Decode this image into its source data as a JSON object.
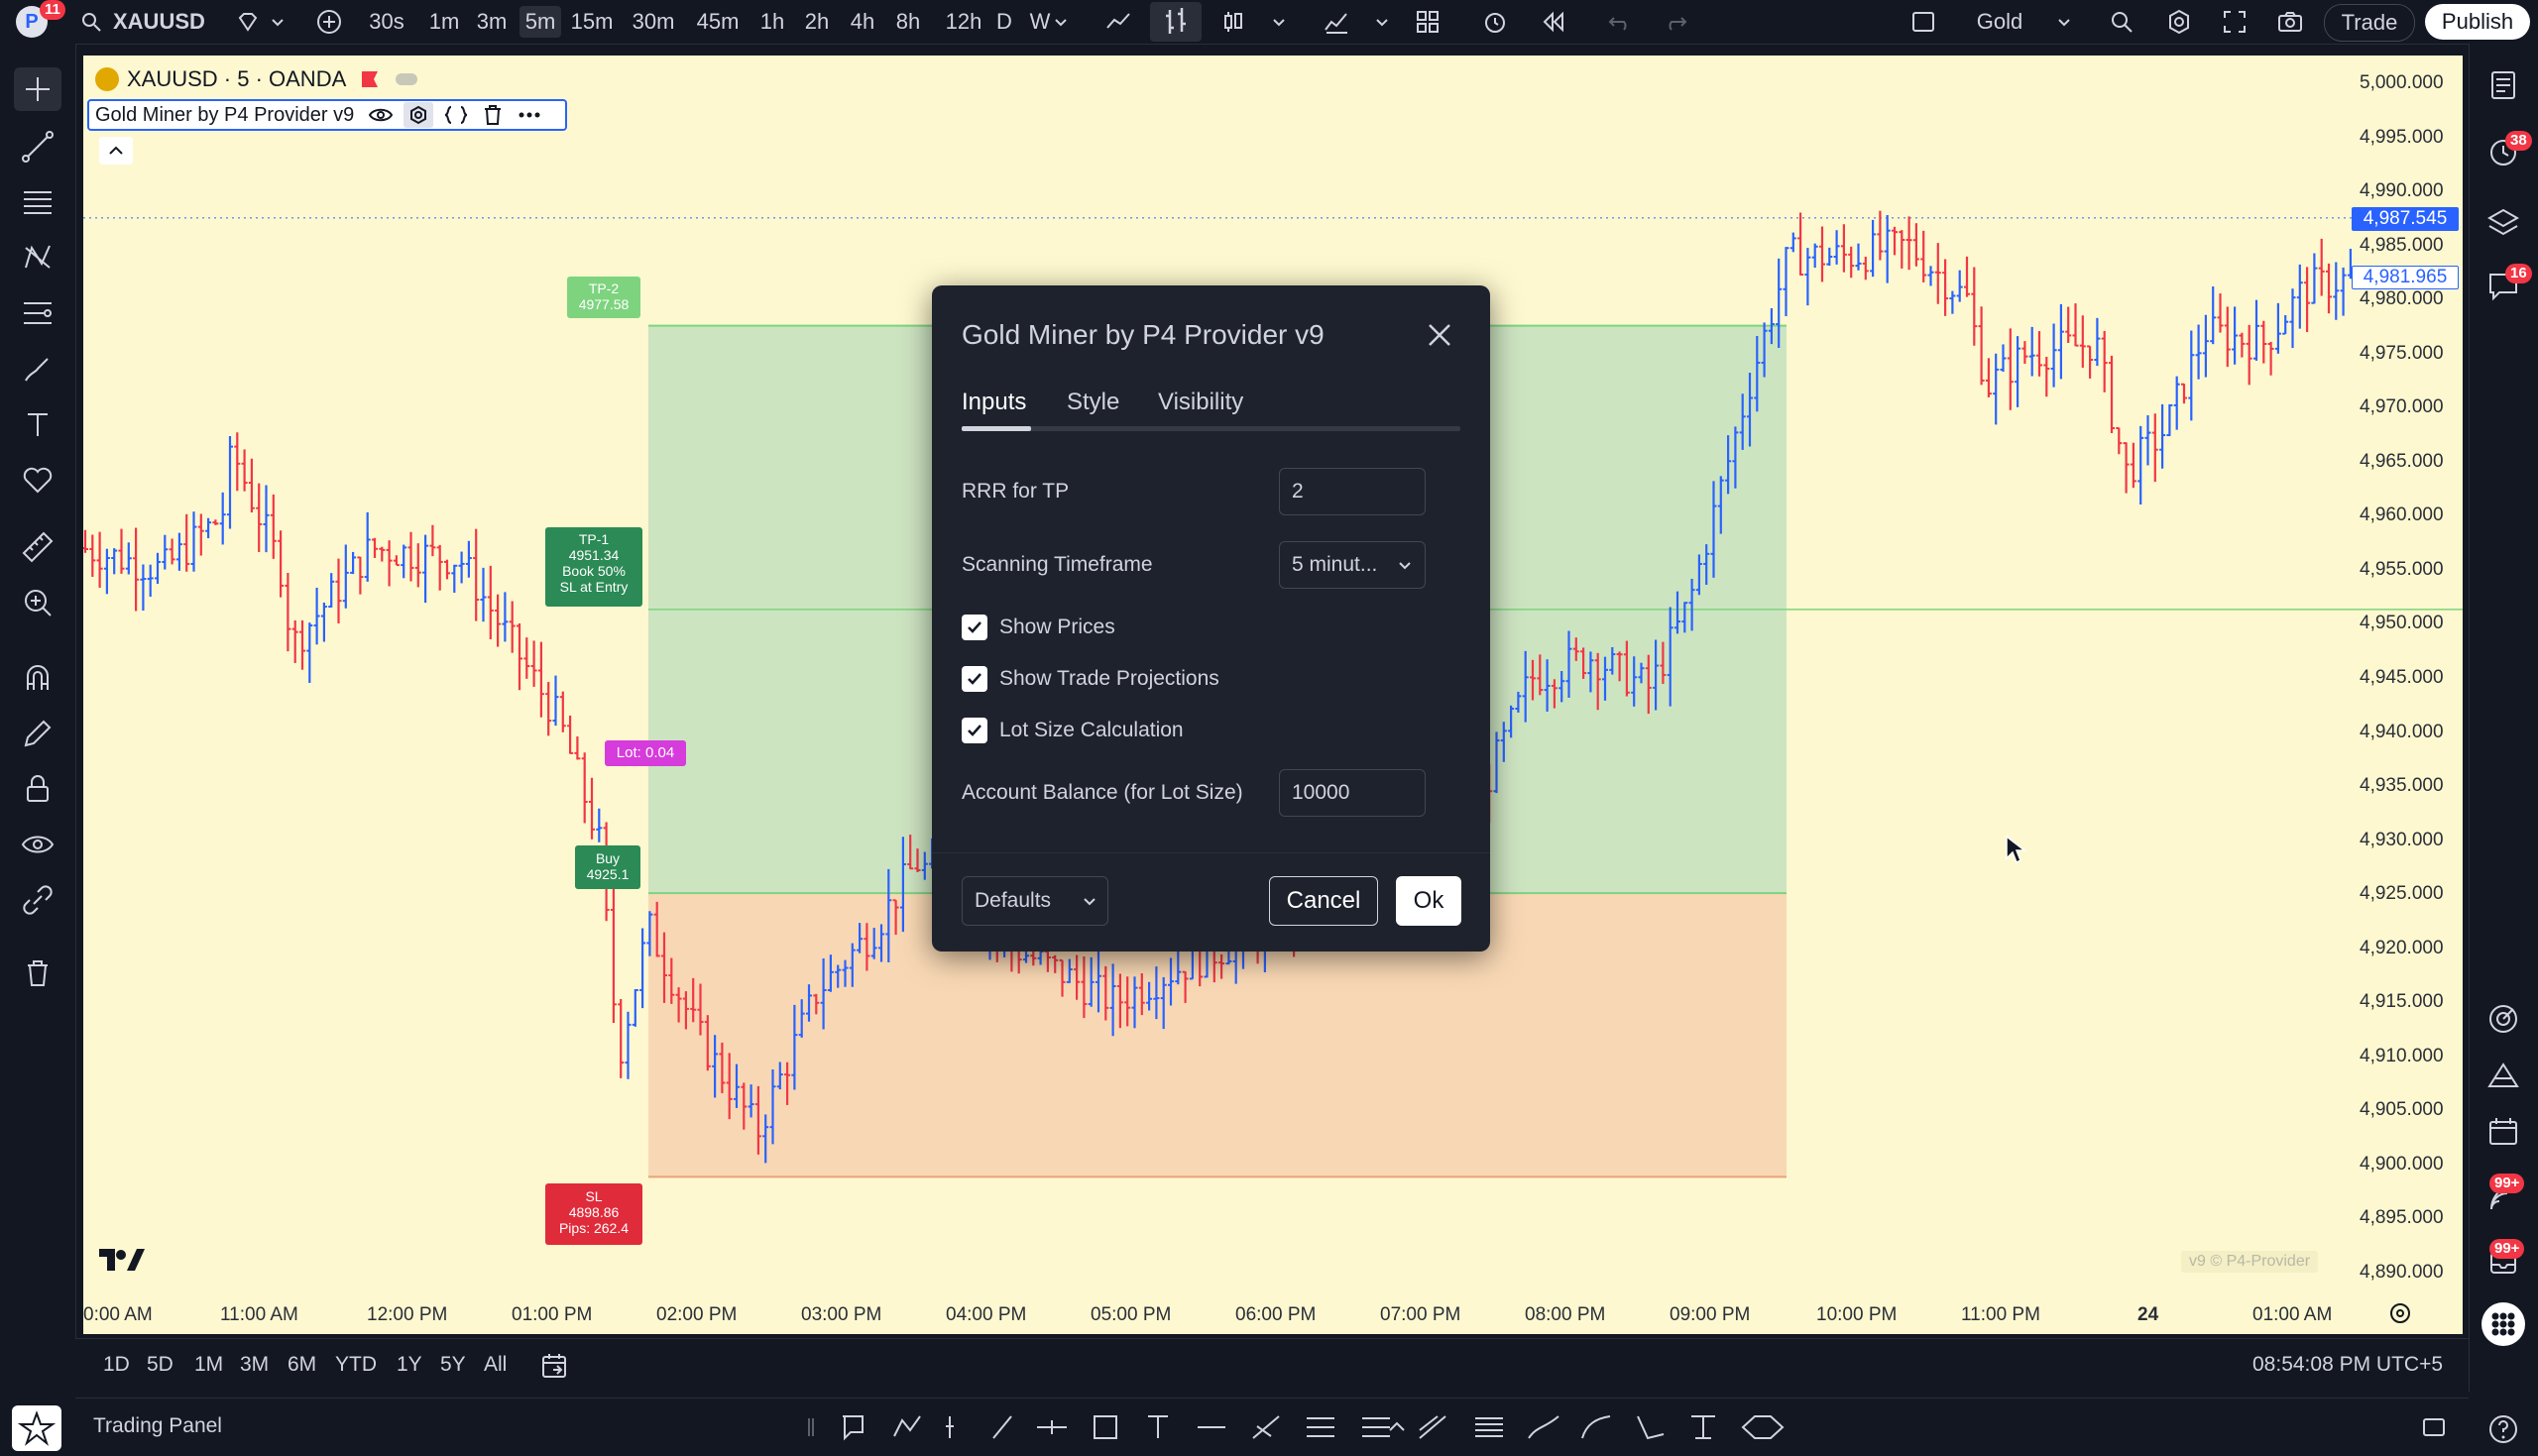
{
  "top_bar": {
    "account_badge": "11",
    "symbol": "XAUUSD",
    "timeframes": [
      "30s",
      "1m",
      "3m",
      "5m",
      "15m",
      "30m",
      "45m",
      "1h",
      "2h",
      "4h",
      "8h",
      "12h",
      "D",
      "W"
    ],
    "active_timeframe": "5m",
    "layout_name": "Gold",
    "trade_label": "Trade",
    "publish_label": "Publish"
  },
  "chart_header": {
    "title": "XAUUSD · 5 · OANDA",
    "indicator_name": "Gold Miner by P4 Provider v9"
  },
  "chart_data": {
    "type": "candlestick",
    "y_axis_labels": [
      "5,000.000",
      "4,995.000",
      "4,990.000",
      "4,985.000",
      "4,980.000",
      "4,975.000",
      "4,970.000",
      "4,965.000",
      "4,960.000",
      "4,955.000",
      "4,950.000",
      "4,945.000",
      "4,940.000",
      "4,935.000",
      "4,930.000",
      "4,925.000",
      "4,920.000",
      "4,915.000",
      "4,910.000",
      "4,905.000",
      "4,900.000",
      "4,895.000",
      "4,890.000"
    ],
    "x_axis_labels": [
      "0:00 AM",
      "11:00 AM",
      "12:00 PM",
      "01:00 PM",
      "02:00 PM",
      "03:00 PM",
      "04:00 PM",
      "05:00 PM",
      "06:00 PM",
      "07:00 PM",
      "08:00 PM",
      "09:00 PM",
      "10:00 PM",
      "11:00 PM",
      "24",
      "01:00 AM"
    ],
    "price_tags": [
      "4,987.545",
      "4,981.965"
    ],
    "trade_labels": {
      "tp2": [
        "TP-2",
        "4977.58"
      ],
      "tp1": [
        "TP-1",
        "4951.34",
        "Book 50%",
        "SL at Entry"
      ],
      "lot": "Lot: 0.04",
      "buy": [
        "Buy",
        "4925.1"
      ],
      "sl": [
        "SL",
        "4898.86",
        "Pips: 262.4"
      ]
    },
    "watermark": "v9 © P4-Provider",
    "levels": {
      "tp2": 4977.58,
      "tp1": 4951.34,
      "entry": 4925.1,
      "sl": 4898.86
    },
    "colors": {
      "up": "#2962ff",
      "down": "#f23645",
      "profit_zone": "#cde4c1",
      "loss_zone": "#f8d8b4"
    }
  },
  "dialog": {
    "title": "Gold Miner by P4 Provider v9",
    "tabs": [
      "Inputs",
      "Style",
      "Visibility"
    ],
    "active_tab": "Inputs",
    "fields": {
      "rrr_label": "RRR for TP",
      "rrr_value": "2",
      "scanning_label": "Scanning Timeframe",
      "scanning_value": "5 minut...",
      "show_prices_label": "Show Prices",
      "show_trade_projections_label": "Show Trade Projections",
      "lot_size_label": "Lot Size Calculation",
      "account_balance_label": "Account Balance (for Lot Size)",
      "account_balance_value": "10000"
    },
    "defaults_label": "Defaults",
    "cancel_label": "Cancel",
    "ok_label": "Ok"
  },
  "right_badges": [
    "38",
    "16",
    "99+",
    "99+"
  ],
  "bottom_bar": {
    "ranges": [
      "1D",
      "5D",
      "1M",
      "3M",
      "6M",
      "YTD",
      "1Y",
      "5Y",
      "All"
    ],
    "clock": "08:54:08 PM UTC+5"
  },
  "panel_bar": {
    "label": "Trading Panel"
  }
}
